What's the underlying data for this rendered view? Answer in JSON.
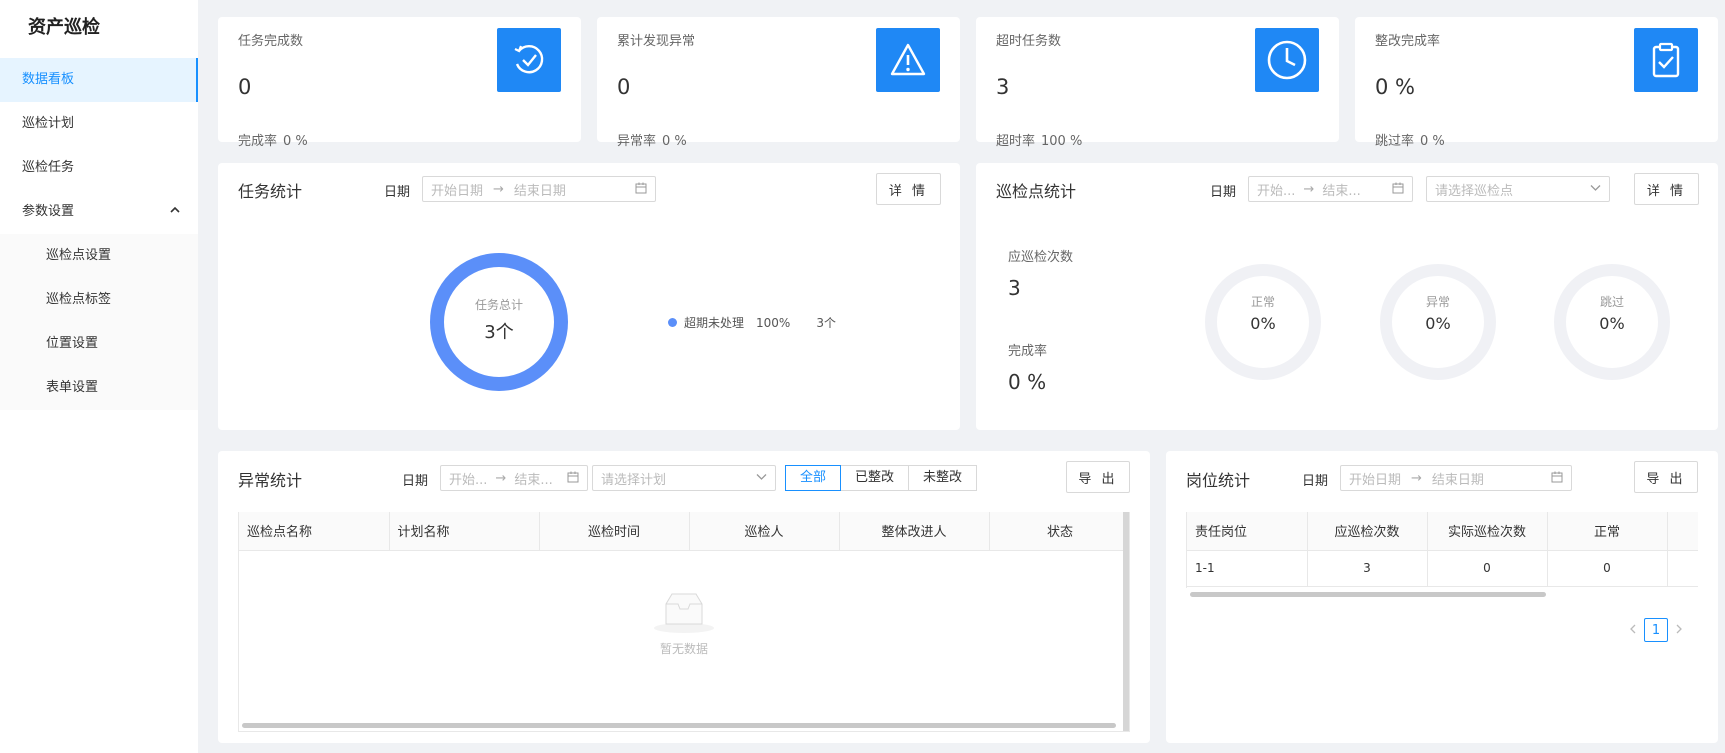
{
  "sidebar": {
    "brand": "资产巡检",
    "items": [
      {
        "label": "数据看板"
      },
      {
        "label": "巡检计划"
      },
      {
        "label": "巡检任务"
      },
      {
        "label": "参数设置"
      }
    ],
    "submenu": [
      {
        "label": "巡检点设置"
      },
      {
        "label": "巡检点标签"
      },
      {
        "label": "位置设置"
      },
      {
        "label": "表单设置"
      }
    ]
  },
  "stats": [
    {
      "title": "任务完成数",
      "value": "0",
      "sub_label": "完成率",
      "sub_value": "0 %",
      "icon": "check-cycle-icon"
    },
    {
      "title": "累计发现异常",
      "value": "0",
      "sub_label": "异常率",
      "sub_value": "0 %",
      "icon": "warning-icon"
    },
    {
      "title": "超时任务数",
      "value": "3",
      "sub_label": "超时率",
      "sub_value": "100 %",
      "icon": "clock-icon"
    },
    {
      "title": "整改完成率",
      "value": "0 %",
      "sub_label": "跳过率",
      "sub_value": "0 %",
      "icon": "clipboard-check-icon"
    }
  ],
  "task_stats": {
    "title": "任务统计",
    "date_label": "日期",
    "start_placeholder": "开始日期",
    "end_placeholder": "结束日期",
    "detail_button": "详 情",
    "donut_label": "任务总计",
    "donut_value": "3个",
    "legend": {
      "name": "超期未处理",
      "percent": "100%",
      "count": "3个",
      "color": "#5b8ff9"
    }
  },
  "point_stats": {
    "title": "巡检点统计",
    "date_label": "日期",
    "start_placeholder": "开始...",
    "end_placeholder": "结束...",
    "point_placeholder": "请选择巡检点",
    "detail_button": "详 情",
    "planned_label": "应巡检次数",
    "planned_value": "3",
    "rate_label": "完成率",
    "rate_value": "0 %",
    "rings": [
      {
        "label": "正常",
        "value": "0%"
      },
      {
        "label": "异常",
        "value": "0%"
      },
      {
        "label": "跳过",
        "value": "0%"
      }
    ]
  },
  "anomaly_stats": {
    "title": "异常统计",
    "date_label": "日期",
    "start_placeholder": "开始...",
    "end_placeholder": "结束...",
    "plan_placeholder": "请选择计划",
    "filters": [
      "全部",
      "已整改",
      "未整改"
    ],
    "export_button": "导 出",
    "columns": [
      "巡检点名称",
      "计划名称",
      "巡检时间",
      "巡检人",
      "整体改进人",
      "状态"
    ],
    "empty_text": "暂无数据"
  },
  "post_stats": {
    "title": "岗位统计",
    "date_label": "日期",
    "start_placeholder": "开始日期",
    "end_placeholder": "结束日期",
    "export_button": "导 出",
    "columns": [
      "责任岗位",
      "应巡检次数",
      "实际巡检次数",
      "正常"
    ],
    "rows": [
      [
        "1-1",
        "3",
        "0",
        "0"
      ]
    ],
    "page": "1"
  }
}
